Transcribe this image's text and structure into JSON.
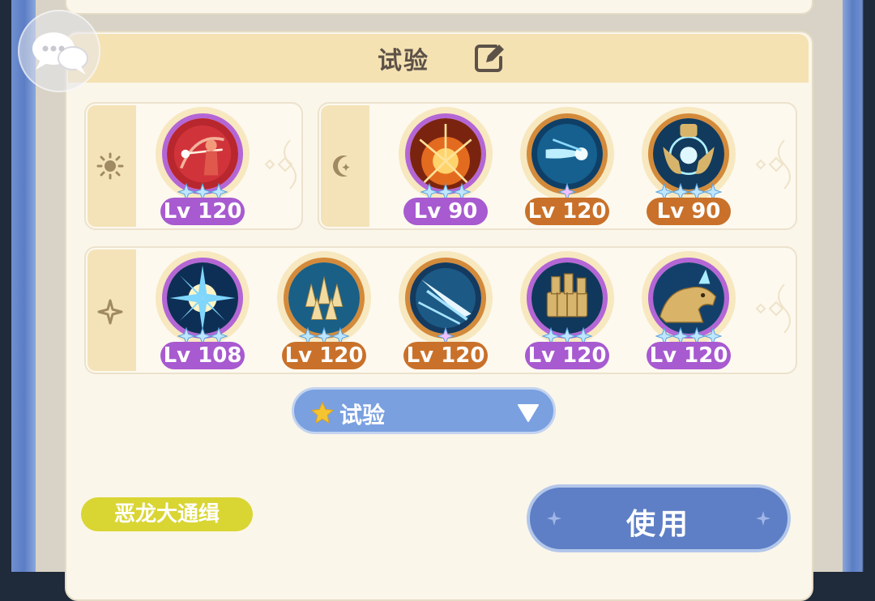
{
  "header": {
    "title": "试验"
  },
  "groups": [
    {
      "icon": "sun-icon",
      "skills": [
        {
          "level": "Lv 120",
          "frame": "purple",
          "stars": 3,
          "art": "red-archer"
        }
      ]
    },
    {
      "icon": "moon-icon",
      "skills": [
        {
          "level": "Lv 90",
          "frame": "purple",
          "stars": 3,
          "art": "fire-burst"
        },
        {
          "level": "Lv 120",
          "frame": "orange",
          "stars": 1,
          "art": "ice-comet"
        },
        {
          "level": "Lv 90",
          "frame": "orange",
          "stars": 4,
          "art": "gold-sigil"
        }
      ]
    },
    {
      "icon": "sparkle-icon",
      "skills": [
        {
          "level": "Lv 108",
          "frame": "purple",
          "stars": 3,
          "art": "ice-burst"
        },
        {
          "level": "Lv 120",
          "frame": "orange",
          "stars": 3,
          "art": "ice-spikes"
        },
        {
          "level": "Lv 120",
          "frame": "orange",
          "stars": 1,
          "art": "ice-claw"
        },
        {
          "level": "Lv 120",
          "frame": "purple",
          "stars": 3,
          "art": "gold-blocks"
        },
        {
          "level": "Lv 120",
          "frame": "purple",
          "stars": 4,
          "art": "gold-beast"
        }
      ]
    }
  ],
  "dropdown": {
    "label": "试验"
  },
  "tag": {
    "label": "恶龙大通缉"
  },
  "use_button": {
    "label": "使用"
  },
  "colors": {
    "purple": "#a85ad0",
    "orange": "#c9712a",
    "button": "#5e7fc6",
    "tag": "#d9d533"
  }
}
